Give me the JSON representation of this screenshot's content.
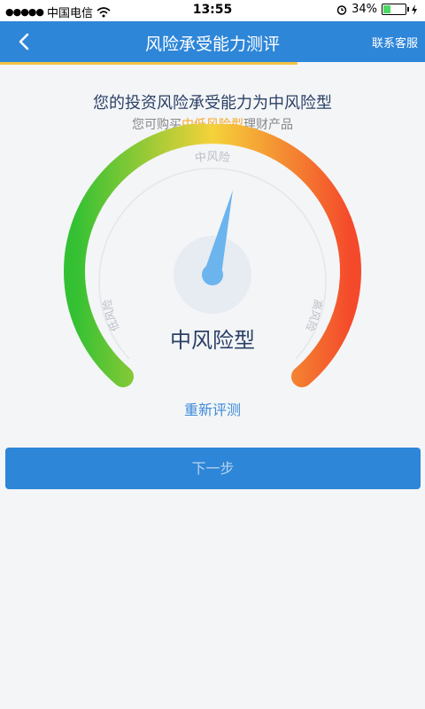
{
  "status": {
    "signal": "●●●●●",
    "carrier": "中国电信",
    "time": "13:55",
    "battery": "34%",
    "battery_level": 0.34
  },
  "nav": {
    "title": "风险承受能力测评",
    "right": "联系客服",
    "progress_fraction": 0.7
  },
  "headline": "您的投资风险承受能力为中风险型",
  "subline": {
    "prefix": "您可购买",
    "highlight": "中低风险型",
    "suffix": "理财产品"
  },
  "gauge": {
    "top_label": "中风险",
    "left_label": "低风险",
    "right_label": "高风险",
    "level": 0.55,
    "colors": [
      "#33c133",
      "#f5d23a",
      "#f44a2b"
    ]
  },
  "result": "中风险型",
  "retest": "重新评测",
  "next": "下一步",
  "colors": {
    "primary": "#2e86d8",
    "accent": "#f6a623"
  }
}
